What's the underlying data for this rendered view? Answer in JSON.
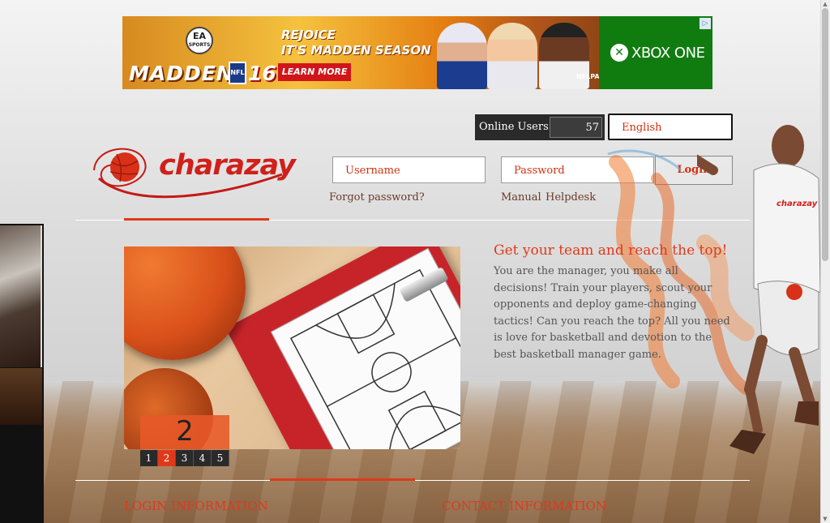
{
  "ad": {
    "brand": "EA",
    "brand_sub": "SPORTS",
    "game": "MADDEN",
    "league": "NFL",
    "edition": "16",
    "headline_line1": "REJOICE",
    "headline_line2": "IT'S MADDEN SEASON",
    "cta": "LEARN MORE",
    "players_badge": "NFLPA",
    "platform": "XBOX ONE",
    "choices_icon": "ad-choices-icon"
  },
  "header": {
    "online_users_label": "Online Users",
    "online_users_count": "57",
    "language_selected": "English"
  },
  "logo": {
    "text": "charazay"
  },
  "login": {
    "username_placeholder": "Username",
    "password_placeholder": "Password",
    "login_label": "Login",
    "forgot_password": "Forgot password?",
    "manual": "Manual",
    "helpdesk": "Helpdesk"
  },
  "slider": {
    "current_slide": "2",
    "pages": [
      "1",
      "2",
      "3",
      "4",
      "5"
    ],
    "active_page_index": 1
  },
  "intro": {
    "title": "Get your team and reach the top!",
    "body": "You are the manager, you make all decisions! Train your players, scout your opponents and deploy game-changing tactics! Can you reach the top? All you need is love for basketball and devotion to the best basketball manager game."
  },
  "sections": {
    "login_information": "LOGIN INFORMATION",
    "contact_information": "CONTACT INFORMATION"
  },
  "mascot": {
    "jersey_text": "charazay"
  },
  "colors": {
    "accent": "#e0391a",
    "xbox_green": "#107c10",
    "dark_box": "#2a2a2a"
  }
}
